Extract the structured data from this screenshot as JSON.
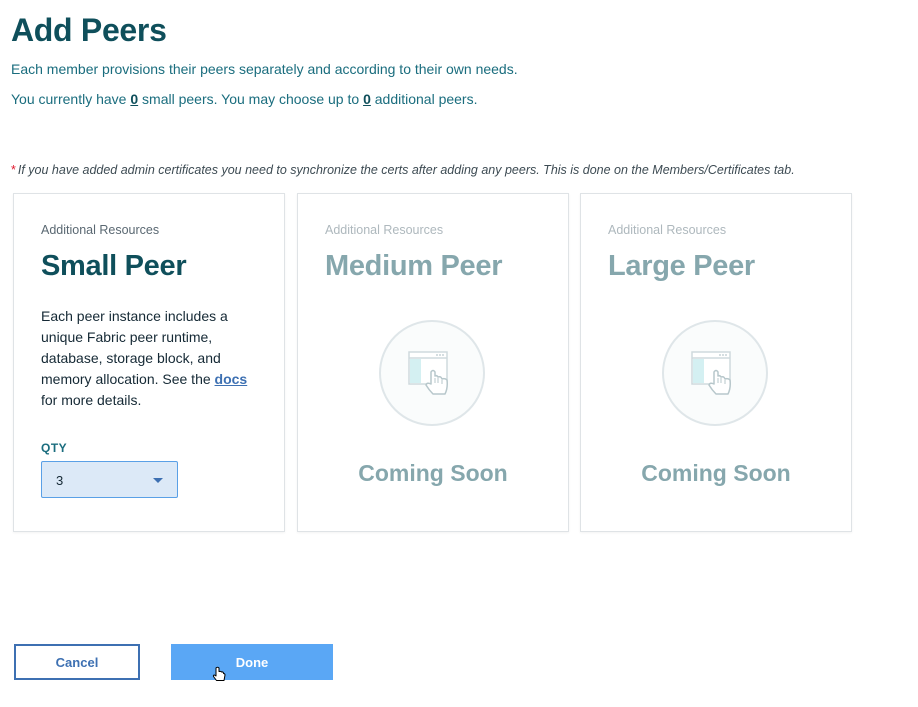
{
  "page": {
    "title": "Add Peers",
    "subtitle": "Each member provisions their peers separately and according to their own needs.",
    "info": {
      "prefix": "You currently have ",
      "current_count": "0",
      "middle": " small peers. You may choose up to ",
      "max_count": "0",
      "suffix": " additional peers."
    },
    "note": {
      "asterisk": "*",
      "text": "If you have added admin certificates you need to synchronize the certs after adding any peers. This is done on the Members/Certificates tab."
    }
  },
  "cards": {
    "small": {
      "eyebrow": "Additional Resources",
      "title": "Small Peer",
      "desc_before": "Each peer instance includes a unique Fabric peer runtime, database, storage block, and memory allocation. See the ",
      "desc_link": "docs",
      "desc_after": " for more details.",
      "qty_label": "QTY",
      "qty_value": "3"
    },
    "medium": {
      "eyebrow": "Additional Resources",
      "title": "Medium Peer",
      "status": "Coming Soon",
      "icon": "touch-screen-icon"
    },
    "large": {
      "eyebrow": "Additional Resources",
      "title": "Large Peer",
      "status": "Coming Soon",
      "icon": "touch-screen-icon"
    }
  },
  "actions": {
    "cancel_label": "Cancel",
    "done_label": "Done"
  },
  "colors": {
    "title": "#0f4f5b",
    "accent": "#3d70b2",
    "primary_button": "#5aa7f5",
    "required": "#e0182d"
  }
}
